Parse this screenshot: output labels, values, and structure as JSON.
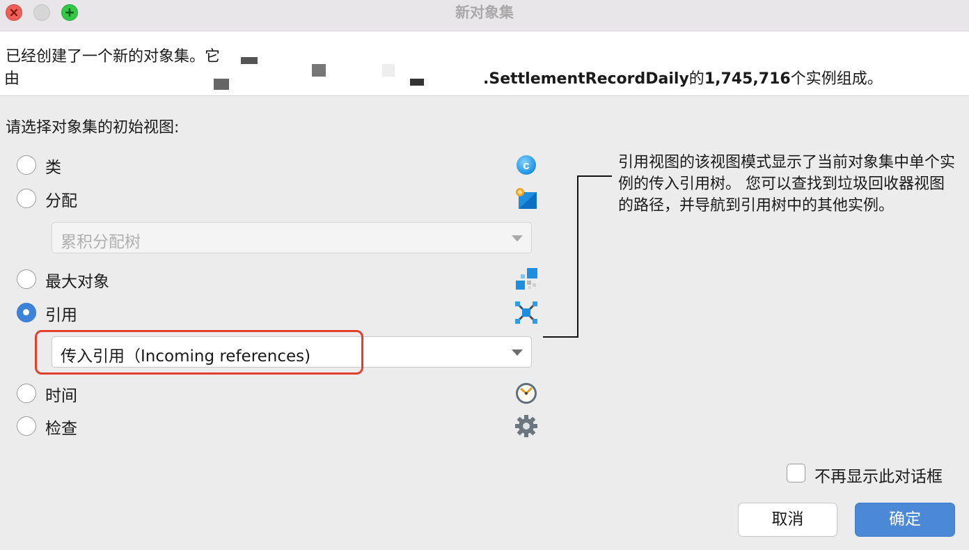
{
  "window": {
    "title": "新对象集"
  },
  "info": {
    "line1": "已经创建了一个新的对象集。它",
    "line2_prefix": "由",
    "class_name": ".SettlementRecordDaily",
    "line2_middle": "的",
    "instance_count": "1,745,716",
    "line2_suffix": "个实例组成。"
  },
  "section_label": "请选择对象集的初始视图:",
  "options": [
    {
      "label": "类",
      "icon": "class-c-icon",
      "checked": false
    },
    {
      "label": "分配",
      "icon": "allocation-icon",
      "checked": false
    },
    {
      "label": "最大对象",
      "icon": "biggest-objects-icon",
      "checked": false
    },
    {
      "label": "引用",
      "icon": "references-icon",
      "checked": true
    },
    {
      "label": "时间",
      "icon": "clock-icon",
      "checked": false
    },
    {
      "label": "检查",
      "icon": "gear-icon",
      "checked": false
    }
  ],
  "allocation_select": {
    "value": "累积分配树",
    "disabled": true
  },
  "references_select": {
    "value": "传入引用（Incoming references)"
  },
  "description": "引用视图的该视图模式显示了当前对象集中单个实例的传入引用树。 您可以查找到垃圾回收器视图的路径，并导航到引用树中的其他实例。",
  "dont_show_label": "不再显示此对话框",
  "buttons": {
    "cancel": "取消",
    "ok": "确定"
  },
  "colors": {
    "accent": "#4b89d6",
    "highlight": "#e0402d"
  }
}
